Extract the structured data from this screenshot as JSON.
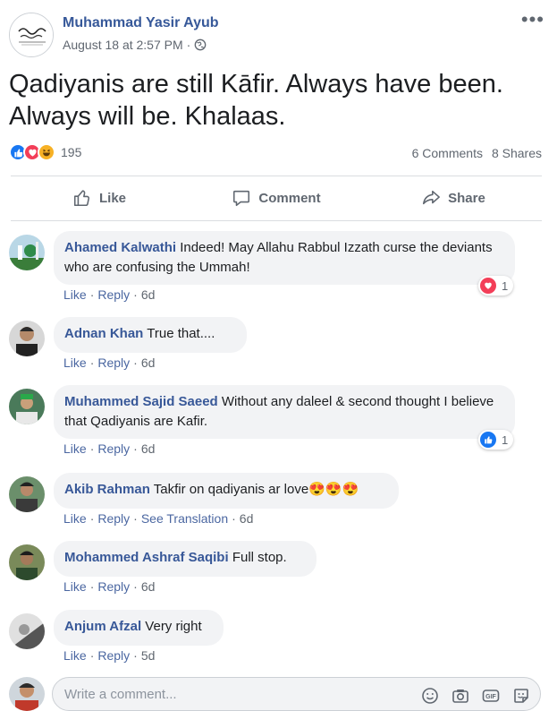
{
  "post": {
    "author": "Muhammad Yasir Ayub",
    "timestamp": "August 18 at 2:57 PM",
    "separator": "·",
    "privacy_icon": "globe-icon",
    "text": "Qadiyanis are still Kāfir. Always have been. Always will be. Khalaas.",
    "reaction_count": "195",
    "reactions": [
      "like",
      "love",
      "haha"
    ],
    "comments_count": "6 Comments",
    "shares_count": "8 Shares"
  },
  "actions": {
    "like": "Like",
    "comment": "Comment",
    "share": "Share"
  },
  "comments": [
    {
      "name": "Ahamed Kalwathi",
      "text": "Indeed! May Allahu Rabbul Izzath curse the deviants who are confusing the Ummah!",
      "like": "Like",
      "reply": "Reply",
      "time": "6d",
      "reaction": "love",
      "reaction_count": "1"
    },
    {
      "name": "Adnan Khan",
      "text": "True that....",
      "like": "Like",
      "reply": "Reply",
      "time": "6d"
    },
    {
      "name": "Muhammed Sajid Saeed",
      "text": "Without any daleel & second thought I believe that Qadiyanis are Kafir.",
      "like": "Like",
      "reply": "Reply",
      "time": "6d",
      "reaction": "like",
      "reaction_count": "1"
    },
    {
      "name": "Akib Rahman",
      "text": "Takfir on qadiyanis ar love",
      "emoji": "😍😍😍",
      "like": "Like",
      "reply": "Reply",
      "see_translation": "See Translation",
      "time": "6d"
    },
    {
      "name": "Mohammed Ashraf Saqibi",
      "text": "Full stop.",
      "like": "Like",
      "reply": "Reply",
      "time": "6d"
    },
    {
      "name": "Anjum Afzal",
      "text": "Very right",
      "like": "Like",
      "reply": "Reply",
      "time": "5d"
    }
  ],
  "composer": {
    "placeholder": "Write a comment...",
    "icons": [
      "emoji-icon",
      "camera-icon",
      "gif-icon",
      "sticker-icon"
    ]
  },
  "colors": {
    "name_blue": "#385898",
    "link_blue": "#4b67a1",
    "bubble_bg": "#f2f3f5",
    "like_blue": "#1877f2",
    "love_red": "#f33e58",
    "haha_yellow": "#f7b125"
  }
}
